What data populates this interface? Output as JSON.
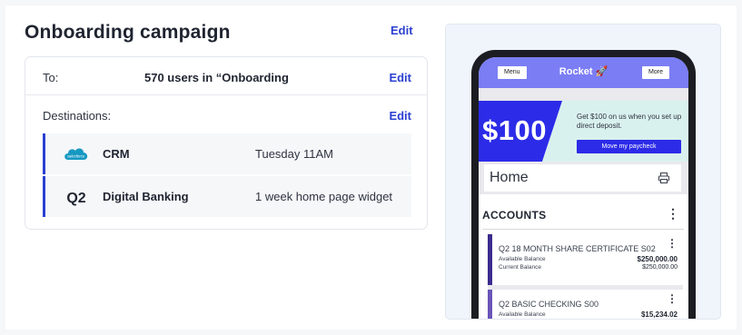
{
  "campaign": {
    "title": "Onboarding campaign",
    "edit_label": "Edit"
  },
  "audience": {
    "label": "To:",
    "value": "570  users in “Onboarding",
    "edit_label": "Edit"
  },
  "destinations": {
    "label": "Destinations:",
    "edit_label": "Edit",
    "items": [
      {
        "logo": "salesforce-logo",
        "logo_text": "salesforce",
        "name": "CRM",
        "schedule": "Tuesday 11AM"
      },
      {
        "logo": "q2-logo",
        "logo_text": "Q2",
        "name": "Digital Banking",
        "schedule": "1 week home page widget"
      }
    ]
  },
  "preview": {
    "app_bar": {
      "menu_label": "Menu",
      "brand": "Rocket",
      "brand_icon": "rocket-icon",
      "more_label": "More"
    },
    "promo": {
      "amount": "$100",
      "text": "Get $100 on us when you set up direct deposit.",
      "cta": "Move my paycheck"
    },
    "home": {
      "title": "Home",
      "icon": "printer-icon"
    },
    "accounts": {
      "heading": "ACCOUNTS",
      "items": [
        {
          "name": "Q2 18 MONTH SHARE CERTIFICATE S02",
          "available_label": "Available Balance",
          "available": "$250,000.00",
          "current_label": "Current Balance",
          "current": "$250,000.00"
        },
        {
          "name": "Q2 BASIC CHECKING S00",
          "available_label": "Available Balance",
          "available": "$15,234.02"
        }
      ]
    }
  },
  "colors": {
    "accent": "#2b3fd1",
    "app_bar": "#7b7df4",
    "promo_blue": "#2c2be8",
    "promo_bg": "#d9f1ee"
  }
}
